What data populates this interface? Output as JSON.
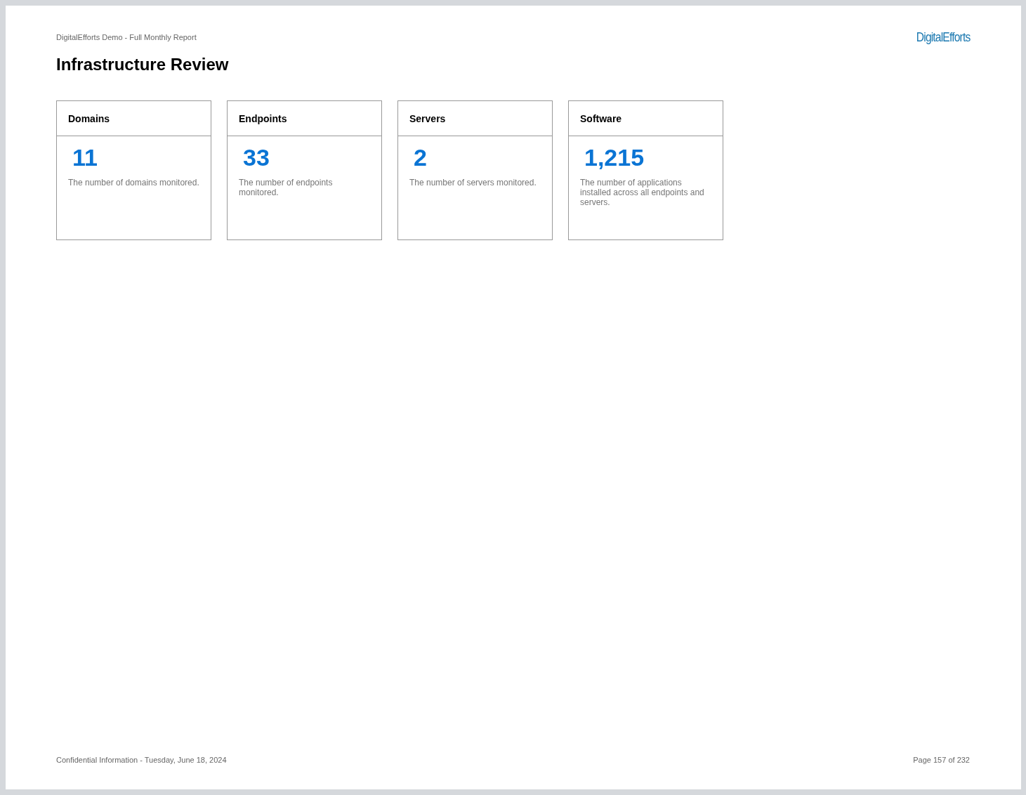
{
  "header": {
    "report_title": "DigitalEfforts Demo - Full Monthly Report",
    "logo": "DigitalEfforts"
  },
  "page_title": "Infrastructure Review",
  "cards": [
    {
      "title": "Domains",
      "value": "11",
      "description": "The number of domains monitored."
    },
    {
      "title": "Endpoints",
      "value": "33",
      "description": "The number of endpoints monitored."
    },
    {
      "title": "Servers",
      "value": "2",
      "description": "The number of servers monitored."
    },
    {
      "title": "Software",
      "value": "1,215",
      "description": "The number of applications installed across all endpoints and servers."
    }
  ],
  "footer": {
    "confidential": "Confidential Information - Tuesday, June 18, 2024",
    "page": "Page 157 of 232"
  }
}
